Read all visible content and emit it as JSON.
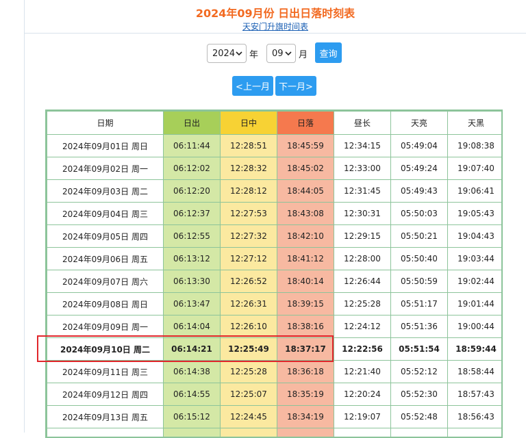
{
  "header": {
    "title": "2024年09月份 日出日落时刻表",
    "sublink": "天安门升旗时间表"
  },
  "controls": {
    "year_value": "2024",
    "year_unit": "年",
    "month_value": "09",
    "month_unit": "月",
    "query_label": "查询",
    "prev_label": "<上一月",
    "next_label": "下一月>"
  },
  "table": {
    "headers": {
      "date": "日期",
      "sunrise": "日出",
      "noon": "日中",
      "sunset": "日落",
      "daylength": "昼长",
      "dawn": "天亮",
      "dusk": "天黑"
    },
    "rows": [
      {
        "date": "2024年09月01日 周日",
        "sunrise": "06:11:44",
        "noon": "12:28:51",
        "sunset": "18:45:59",
        "daylength": "12:34:15",
        "dawn": "05:49:04",
        "dusk": "19:08:38"
      },
      {
        "date": "2024年09月02日 周一",
        "sunrise": "06:12:02",
        "noon": "12:28:32",
        "sunset": "18:45:02",
        "daylength": "12:33:00",
        "dawn": "05:49:24",
        "dusk": "19:07:40"
      },
      {
        "date": "2024年09月03日 周二",
        "sunrise": "06:12:20",
        "noon": "12:28:12",
        "sunset": "18:44:05",
        "daylength": "12:31:45",
        "dawn": "05:49:43",
        "dusk": "19:06:41"
      },
      {
        "date": "2024年09月04日 周三",
        "sunrise": "06:12:37",
        "noon": "12:27:53",
        "sunset": "18:43:08",
        "daylength": "12:30:31",
        "dawn": "05:50:03",
        "dusk": "19:05:43"
      },
      {
        "date": "2024年09月05日 周四",
        "sunrise": "06:12:55",
        "noon": "12:27:32",
        "sunset": "18:42:10",
        "daylength": "12:29:15",
        "dawn": "05:50:21",
        "dusk": "19:04:43"
      },
      {
        "date": "2024年09月06日 周五",
        "sunrise": "06:13:12",
        "noon": "12:27:12",
        "sunset": "18:41:12",
        "daylength": "12:28:00",
        "dawn": "05:50:40",
        "dusk": "19:03:44"
      },
      {
        "date": "2024年09月07日 周六",
        "sunrise": "06:13:30",
        "noon": "12:26:52",
        "sunset": "18:40:14",
        "daylength": "12:26:44",
        "dawn": "05:50:59",
        "dusk": "19:02:44"
      },
      {
        "date": "2024年09月08日 周日",
        "sunrise": "06:13:47",
        "noon": "12:26:31",
        "sunset": "18:39:15",
        "daylength": "12:25:28",
        "dawn": "05:51:17",
        "dusk": "19:01:44"
      },
      {
        "date": "2024年09月09日 周一",
        "sunrise": "06:14:04",
        "noon": "12:26:10",
        "sunset": "18:38:16",
        "daylength": "12:24:12",
        "dawn": "05:51:36",
        "dusk": "19:00:44"
      },
      {
        "date": "2024年09月10日 周二",
        "sunrise": "06:14:21",
        "noon": "12:25:49",
        "sunset": "18:37:17",
        "daylength": "12:22:56",
        "dawn": "05:51:54",
        "dusk": "18:59:44"
      },
      {
        "date": "2024年09月11日 周三",
        "sunrise": "06:14:38",
        "noon": "12:25:28",
        "sunset": "18:36:18",
        "daylength": "12:21:40",
        "dawn": "05:52:12",
        "dusk": "18:58:44"
      },
      {
        "date": "2024年09月12日 周四",
        "sunrise": "06:14:55",
        "noon": "12:25:07",
        "sunset": "18:35:19",
        "daylength": "12:20:24",
        "dawn": "05:52:30",
        "dusk": "18:57:43"
      },
      {
        "date": "2024年09月13日 周五",
        "sunrise": "06:15:12",
        "noon": "12:24:45",
        "sunset": "18:34:19",
        "daylength": "12:19:07",
        "dawn": "05:52:48",
        "dusk": "18:56:43"
      },
      {
        "date": "",
        "sunrise": "",
        "noon": "",
        "sunset": "",
        "daylength": "",
        "dawn": "",
        "dusk": ""
      }
    ]
  },
  "colors": {
    "title": "#f26a21",
    "link": "#1a5fb4",
    "button": "#2d9cf0",
    "table_border": "#8cc49a",
    "sunrise_header": "#a7cf59",
    "noon_header": "#f7d234",
    "sunset_header": "#f5794e",
    "highlight_border": "#e0262b"
  }
}
